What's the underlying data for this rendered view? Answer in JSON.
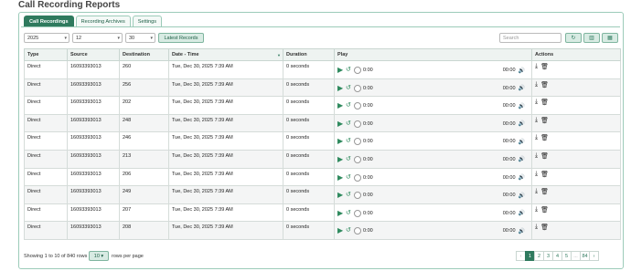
{
  "page_title": "Call Recording Reports",
  "tabs": [
    {
      "label": "Call Recordings",
      "active": true
    },
    {
      "label": "Recording Archives",
      "active": false
    },
    {
      "label": "Settings",
      "active": false
    }
  ],
  "filters": {
    "year": "2025",
    "month": "12",
    "day": "30",
    "latest_label": "Latest Records",
    "search_placeholder": "Search"
  },
  "table": {
    "headers": [
      "Type",
      "Source",
      "Destination",
      "Date - Time",
      "Duration",
      "Play",
      "Actions"
    ],
    "rows": [
      {
        "type": "Direct",
        "source": "16093393013",
        "destination": "260",
        "datetime": "Tue, Dec 30, 2025 7:39 AM",
        "duration": "0 seconds",
        "start": "0:00",
        "end": "00:00"
      },
      {
        "type": "Direct",
        "source": "16093393013",
        "destination": "256",
        "datetime": "Tue, Dec 30, 2025 7:39 AM",
        "duration": "0 seconds",
        "start": "0:00",
        "end": "00:00"
      },
      {
        "type": "Direct",
        "source": "16093393013",
        "destination": "202",
        "datetime": "Tue, Dec 30, 2025 7:39 AM",
        "duration": "0 seconds",
        "start": "0:00",
        "end": "00:00"
      },
      {
        "type": "Direct",
        "source": "16093393013",
        "destination": "248",
        "datetime": "Tue, Dec 30, 2025 7:39 AM",
        "duration": "0 seconds",
        "start": "0:00",
        "end": "00:00"
      },
      {
        "type": "Direct",
        "source": "16093393013",
        "destination": "246",
        "datetime": "Tue, Dec 30, 2025 7:39 AM",
        "duration": "0 seconds",
        "start": "0:00",
        "end": "00:00"
      },
      {
        "type": "Direct",
        "source": "16093393013",
        "destination": "213",
        "datetime": "Tue, Dec 30, 2025 7:39 AM",
        "duration": "0 seconds",
        "start": "0:00",
        "end": "00:00"
      },
      {
        "type": "Direct",
        "source": "16093393013",
        "destination": "206",
        "datetime": "Tue, Dec 30, 2025 7:39 AM",
        "duration": "0 seconds",
        "start": "0:00",
        "end": "00:00"
      },
      {
        "type": "Direct",
        "source": "16093393013",
        "destination": "249",
        "datetime": "Tue, Dec 30, 2025 7:39 AM",
        "duration": "0 seconds",
        "start": "0:00",
        "end": "00:00"
      },
      {
        "type": "Direct",
        "source": "16093393013",
        "destination": "207",
        "datetime": "Tue, Dec 30, 2025 7:39 AM",
        "duration": "0 seconds",
        "start": "0:00",
        "end": "00:00"
      },
      {
        "type": "Direct",
        "source": "16093393013",
        "destination": "208",
        "datetime": "Tue, Dec 30, 2025 7:39 AM",
        "duration": "0 seconds",
        "start": "0:00",
        "end": "00:00"
      }
    ]
  },
  "footer": {
    "showing": "Showing 1 to 10 of 840 rows",
    "page_size": "10",
    "per_page": "rows per page"
  },
  "pagination": [
    "‹",
    "1",
    "2",
    "3",
    "4",
    "5",
    "...",
    "84",
    "›"
  ],
  "icons": {
    "refresh": "refresh-icon",
    "columns": "columns-icon",
    "grid": "grid-icon",
    "play": "play-icon",
    "reload": "reload-icon",
    "volume": "volume-icon",
    "download": "download-icon",
    "trash": "trash-icon"
  },
  "colors": {
    "accent": "#2f7a5e",
    "border": "#9ccbb9"
  }
}
